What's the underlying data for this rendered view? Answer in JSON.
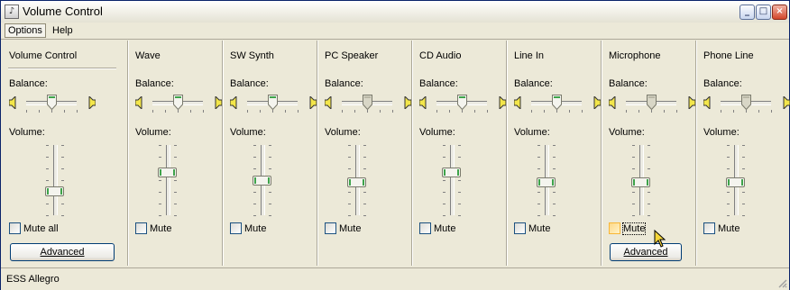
{
  "window": {
    "title": "Volume Control"
  },
  "menu": {
    "options": "Options",
    "help": "Help"
  },
  "channels": [
    {
      "name": "Volume Control",
      "balance_label": "Balance:",
      "volume_label": "Volume:",
      "mute_label": "Mute all",
      "mute_checked": false,
      "balance": 0.5,
      "volume": 0.35,
      "advanced_label": "Advanced"
    },
    {
      "name": "Wave",
      "balance_label": "Balance:",
      "volume_label": "Volume:",
      "mute_label": "Mute",
      "mute_checked": false,
      "balance": 0.5,
      "volume": 0.62
    },
    {
      "name": "SW Synth",
      "balance_label": "Balance:",
      "volume_label": "Volume:",
      "mute_label": "Mute",
      "mute_checked": false,
      "balance": 0.5,
      "volume": 0.5
    },
    {
      "name": "PC Speaker",
      "balance_label": "Balance:",
      "volume_label": "Volume:",
      "mute_label": "Mute",
      "mute_checked": false,
      "balance": 0.5,
      "volume": 0.48
    },
    {
      "name": "CD Audio",
      "balance_label": "Balance:",
      "volume_label": "Volume:",
      "mute_label": "Mute",
      "mute_checked": false,
      "balance": 0.5,
      "volume": 0.62
    },
    {
      "name": "Line In",
      "balance_label": "Balance:",
      "volume_label": "Volume:",
      "mute_label": "Mute",
      "mute_checked": false,
      "balance": 0.5,
      "volume": 0.48
    },
    {
      "name": "Microphone",
      "balance_label": "Balance:",
      "volume_label": "Volume:",
      "mute_label": "Mute",
      "mute_checked": false,
      "balance": 0.5,
      "volume": 0.48,
      "advanced_label": "Advanced"
    },
    {
      "name": "Phone Line",
      "balance_label": "Balance:",
      "volume_label": "Volume:",
      "mute_label": "Mute",
      "mute_checked": false,
      "balance": 0.5,
      "volume": 0.48
    }
  ],
  "status": {
    "device": "ESS Allegro"
  },
  "colors": {
    "thumb_green": "#3ea34a",
    "thumb_dim": "#d8d6c6",
    "selection_border": "#0a246a"
  }
}
